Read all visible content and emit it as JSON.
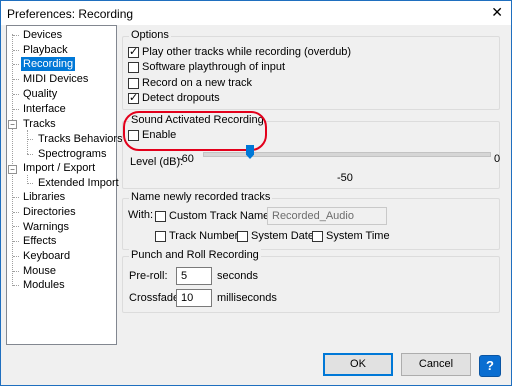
{
  "window": {
    "title": "Preferences: Recording",
    "close_glyph": "✕"
  },
  "tree": {
    "items": [
      {
        "label": "Devices"
      },
      {
        "label": "Playback"
      },
      {
        "label": "Recording"
      },
      {
        "label": "MIDI Devices"
      },
      {
        "label": "Quality"
      },
      {
        "label": "Interface"
      },
      {
        "label": "Tracks"
      },
      {
        "label": "Tracks Behaviors"
      },
      {
        "label": "Spectrograms"
      },
      {
        "label": "Import / Export"
      },
      {
        "label": "Extended Import"
      },
      {
        "label": "Libraries"
      },
      {
        "label": "Directories"
      },
      {
        "label": "Warnings"
      },
      {
        "label": "Effects"
      },
      {
        "label": "Keyboard"
      },
      {
        "label": "Mouse"
      },
      {
        "label": "Modules"
      }
    ],
    "selected": "Recording",
    "expander_minus": "−"
  },
  "options": {
    "title": "Options",
    "play_other": "Play other tracks while recording (overdub)",
    "software_playthrough": "Software playthrough of input",
    "record_new_track": "Record on a new track",
    "detect_dropouts": "Detect dropouts"
  },
  "sound_activated": {
    "title": "Sound Activated Recording",
    "enable": "Enable",
    "level_label": "Level (dB):",
    "min": "-60",
    "max": "0",
    "current": "-50",
    "level_value": -50
  },
  "naming": {
    "title": "Name newly recorded tracks",
    "with": "With:",
    "custom_name": "Custom Track Name",
    "custom_value": "Recorded_Audio",
    "track_number": "Track Number",
    "system_date": "System Date",
    "system_time": "System Time"
  },
  "punch": {
    "title": "Punch and Roll Recording",
    "preroll_label": "Pre-roll:",
    "preroll_value": "5",
    "preroll_unit": "seconds",
    "crossfade_label": "Crossfade:",
    "crossfade_value": "10",
    "crossfade_unit": "milliseconds"
  },
  "buttons": {
    "ok": "OK",
    "cancel": "Cancel",
    "help": "?"
  }
}
